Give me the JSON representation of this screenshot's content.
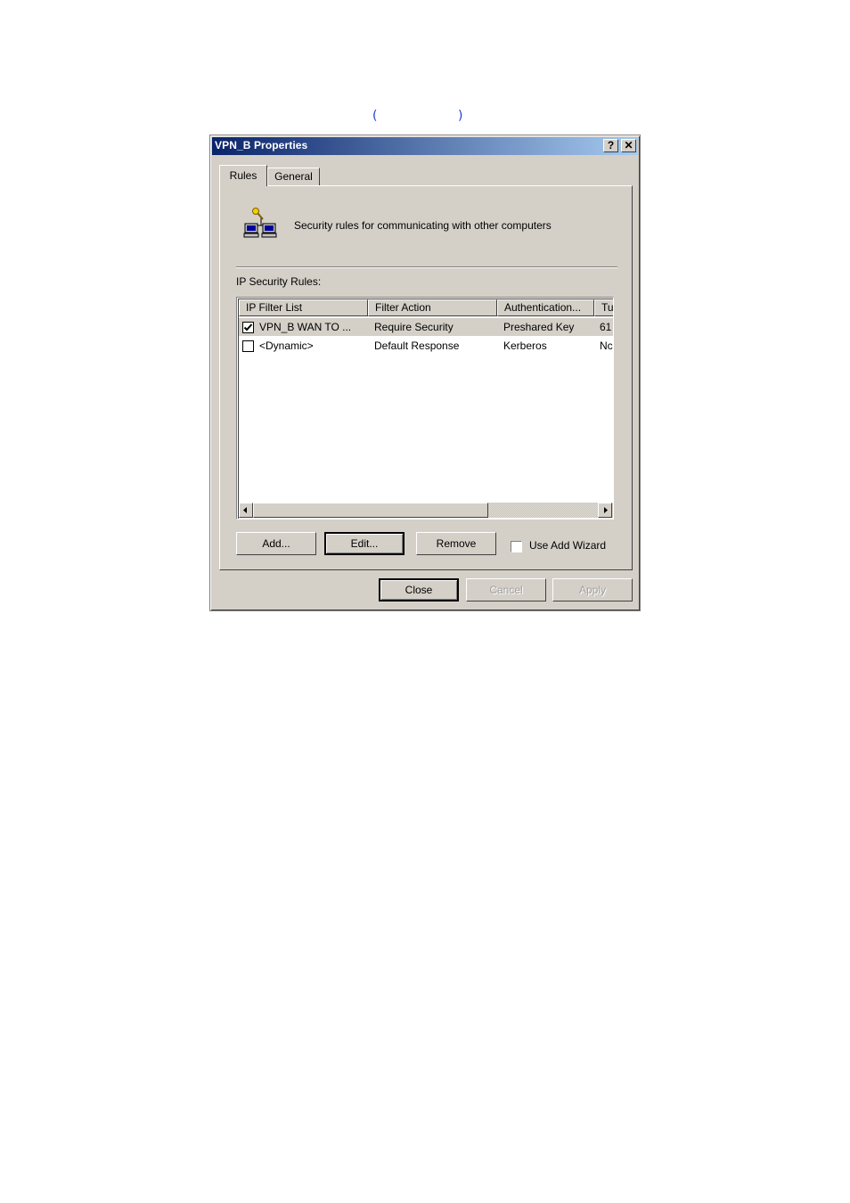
{
  "caption": {
    "open_paren": "(",
    "close_paren": ")"
  },
  "window": {
    "title": "VPN_B Properties",
    "help_label": "?",
    "close_label": "✕"
  },
  "tabs": [
    {
      "label": "Rules",
      "selected": true
    },
    {
      "label": "General",
      "selected": false
    }
  ],
  "rules_tab": {
    "description": "Security rules for communicating with other computers",
    "rules_label": "IP Security Rules:",
    "columns": [
      "IP Filter List",
      "Filter Action",
      "Authentication...",
      "Tu"
    ],
    "rows": [
      {
        "checked": true,
        "filter_list": "VPN_B WAN TO ...",
        "filter_action": "Require Security",
        "authentication": "Preshared Key",
        "tunnel": "61",
        "selected": true
      },
      {
        "checked": false,
        "filter_list": "<Dynamic>",
        "filter_action": "Default Response",
        "authentication": "Kerberos",
        "tunnel": "Nc",
        "selected": false
      }
    ],
    "buttons": {
      "add": "Add...",
      "edit": "Edit...",
      "remove": "Remove"
    },
    "use_add_wizard": {
      "label": "Use Add Wizard",
      "checked": false
    }
  },
  "dialog_buttons": {
    "close": "Close",
    "cancel": "Cancel",
    "apply": "Apply"
  },
  "colors": {
    "title_start": "#0a246a",
    "title_end": "#a6caf0",
    "face": "#d4d0c8",
    "caption": "#1a3fd1"
  }
}
